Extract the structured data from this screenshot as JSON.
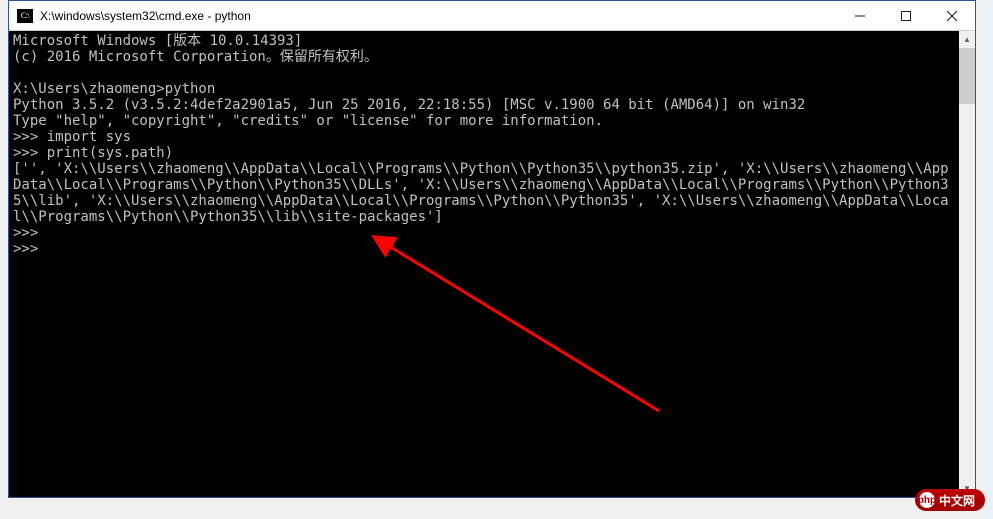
{
  "window": {
    "title": "X:\\windows\\system32\\cmd.exe - python"
  },
  "console": {
    "lines": [
      "Microsoft Windows [版本 10.0.14393]",
      "(c) 2016 Microsoft Corporation。保留所有权利。",
      "",
      "X:\\Users\\zhaomeng>python",
      "Python 3.5.2 (v3.5.2:4def2a2901a5, Jun 25 2016, 22:18:55) [MSC v.1900 64 bit (AMD64)] on win32",
      "Type \"help\", \"copyright\", \"credits\" or \"license\" for more information.",
      ">>> import sys",
      ">>> print(sys.path)",
      "['', 'X:\\\\Users\\\\zhaomeng\\\\AppData\\\\Local\\\\Programs\\\\Python\\\\Python35\\\\python35.zip', 'X:\\\\Users\\\\zhaomeng\\\\AppData\\\\Local\\\\Programs\\\\Python\\\\Python35\\\\DLLs', 'X:\\\\Users\\\\zhaomeng\\\\AppData\\\\Local\\\\Programs\\\\Python\\\\Python35\\\\lib', 'X:\\\\Users\\\\zhaomeng\\\\AppData\\\\Local\\\\Programs\\\\Python\\\\Python35', 'X:\\\\Users\\\\zhaomeng\\\\AppData\\\\Local\\\\Programs\\\\Python\\\\Python35\\\\lib\\\\site-packages']",
      ">>>",
      ">>>"
    ]
  },
  "badge": {
    "prefix": "php",
    "text": "中文网"
  }
}
